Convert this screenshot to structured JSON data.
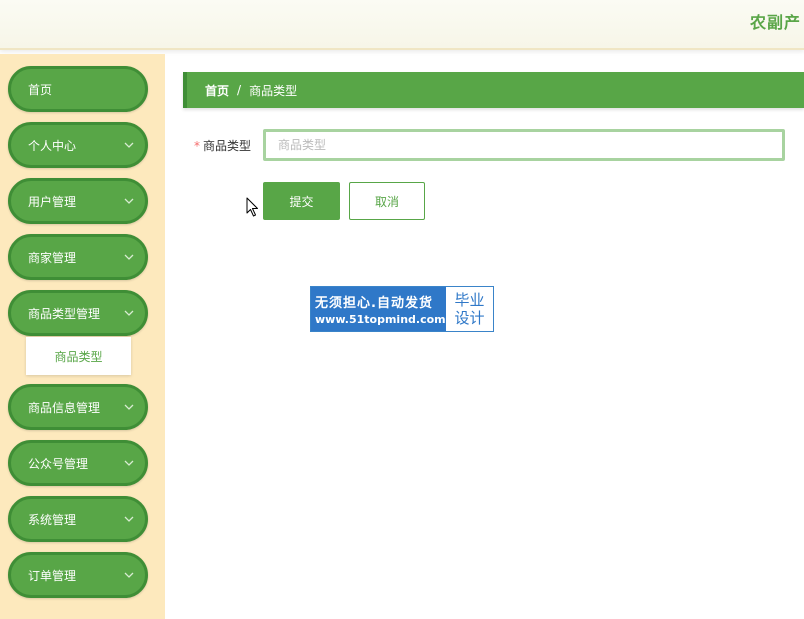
{
  "header": {
    "app_title": "农副产"
  },
  "sidebar": {
    "items": [
      {
        "label": "首页",
        "has_chevron": false
      },
      {
        "label": "个人中心",
        "has_chevron": true
      },
      {
        "label": "用户管理",
        "has_chevron": true
      },
      {
        "label": "商家管理",
        "has_chevron": true
      },
      {
        "label": "商品类型管理",
        "has_chevron": true
      },
      {
        "label": "商品信息管理",
        "has_chevron": true
      },
      {
        "label": "公众号管理",
        "has_chevron": true
      },
      {
        "label": "系统管理",
        "has_chevron": true
      },
      {
        "label": "订单管理",
        "has_chevron": true
      }
    ],
    "submenu": {
      "label": "商品类型"
    }
  },
  "breadcrumb": {
    "home": "首页",
    "separator": "/",
    "current": "商品类型"
  },
  "form": {
    "required_mark": "*",
    "field_label": "商品类型",
    "field_value": "",
    "field_placeholder": "商品类型",
    "submit_label": "提交",
    "cancel_label": "取消"
  },
  "watermark": {
    "line1": "无须担心.自动发货",
    "line2": "www.51topmind.com",
    "right_line1": "毕业",
    "right_line2": "设计"
  },
  "colors": {
    "accent": "#58a647",
    "sidebar_bg": "#fde9bd",
    "required": "#f56c6c"
  }
}
